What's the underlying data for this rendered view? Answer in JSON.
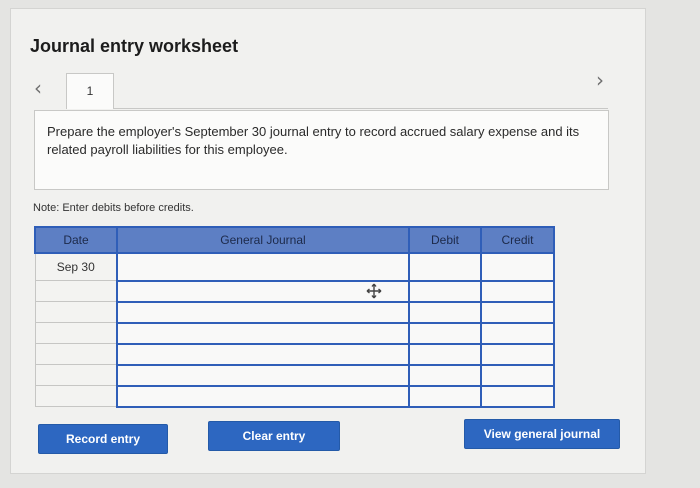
{
  "worksheet": {
    "title": "Journal entry worksheet",
    "tab_label": "1",
    "instruction": "Prepare the employer's September 30 journal entry to record accrued salary expense and its related payroll liabilities for this employee.",
    "note": "Note: Enter debits before credits."
  },
  "journal": {
    "headers": {
      "date": "Date",
      "general_journal": "General Journal",
      "debit": "Debit",
      "credit": "Credit"
    },
    "rows": [
      {
        "date": "Sep 30",
        "account": "",
        "debit": "",
        "credit": ""
      },
      {
        "date": "",
        "account": "",
        "debit": "",
        "credit": ""
      },
      {
        "date": "",
        "account": "",
        "debit": "",
        "credit": ""
      },
      {
        "date": "",
        "account": "",
        "debit": "",
        "credit": ""
      },
      {
        "date": "",
        "account": "",
        "debit": "",
        "credit": ""
      },
      {
        "date": "",
        "account": "",
        "debit": "",
        "credit": ""
      },
      {
        "date": "",
        "account": "",
        "debit": "",
        "credit": ""
      }
    ]
  },
  "buttons": {
    "record": "Record entry",
    "clear": "Clear entry",
    "view": "View general journal"
  },
  "icons": {
    "prev": "chevron-left-icon",
    "next": "chevron-right-icon",
    "cursor": "move-cursor-icon"
  },
  "colors": {
    "header_blue": "#5d7fc4",
    "border_blue": "#2f5eb8",
    "button_blue": "#2d67c1"
  }
}
